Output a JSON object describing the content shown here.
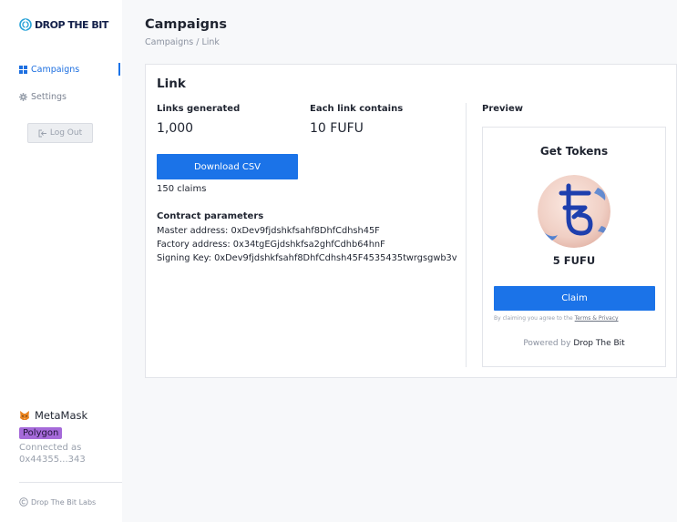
{
  "brand": {
    "logo_text": "DROP THE BIT"
  },
  "sidebar": {
    "items": [
      {
        "label": "Campaigns",
        "icon": "grid-icon",
        "active": true
      },
      {
        "label": "Settings",
        "icon": "gear-icon",
        "active": false
      }
    ],
    "logout_label": "Log Out",
    "wallet": {
      "name": "MetaMask",
      "network": "Polygon",
      "connected_as": "Connected as 0x44355...343"
    },
    "footer": "Drop The Bit Labs"
  },
  "colors": {
    "accent": "#1b73e8",
    "network_badge": "#a56ad9"
  },
  "header": {
    "title": "Campaigns",
    "breadcrumb": "Campaigns / Link"
  },
  "card": {
    "title": "Link",
    "links_generated_label": "Links generated",
    "links_generated_value": "1,000",
    "each_link_label": "Each link contains",
    "each_link_value": "10 FUFU",
    "download_label": "Download CSV",
    "claims": "150 claims",
    "contract_title": "Contract parameters",
    "master_address": "Master address: 0xDev9fjdshkfsahf8DhfCdhsh45F",
    "factory_address": "Factory address: 0x34tgEGjdshkfsa2ghfCdhb64hnF",
    "signing_key": "Signing Key: 0xDev9fjdshkfsahf8DhfCdhsh45F4535435twrgsgwb3v"
  },
  "preview": {
    "label": "Preview",
    "title": "Get Tokens",
    "token_icon": "tezos-icon",
    "amount": "5 FUFU",
    "claim_label": "Claim",
    "terms_prefix": "By claiming you agree to the",
    "terms_link": "Terms & Privacy",
    "powered_prefix": "Powered by",
    "powered_brand": "Drop The Bit"
  }
}
